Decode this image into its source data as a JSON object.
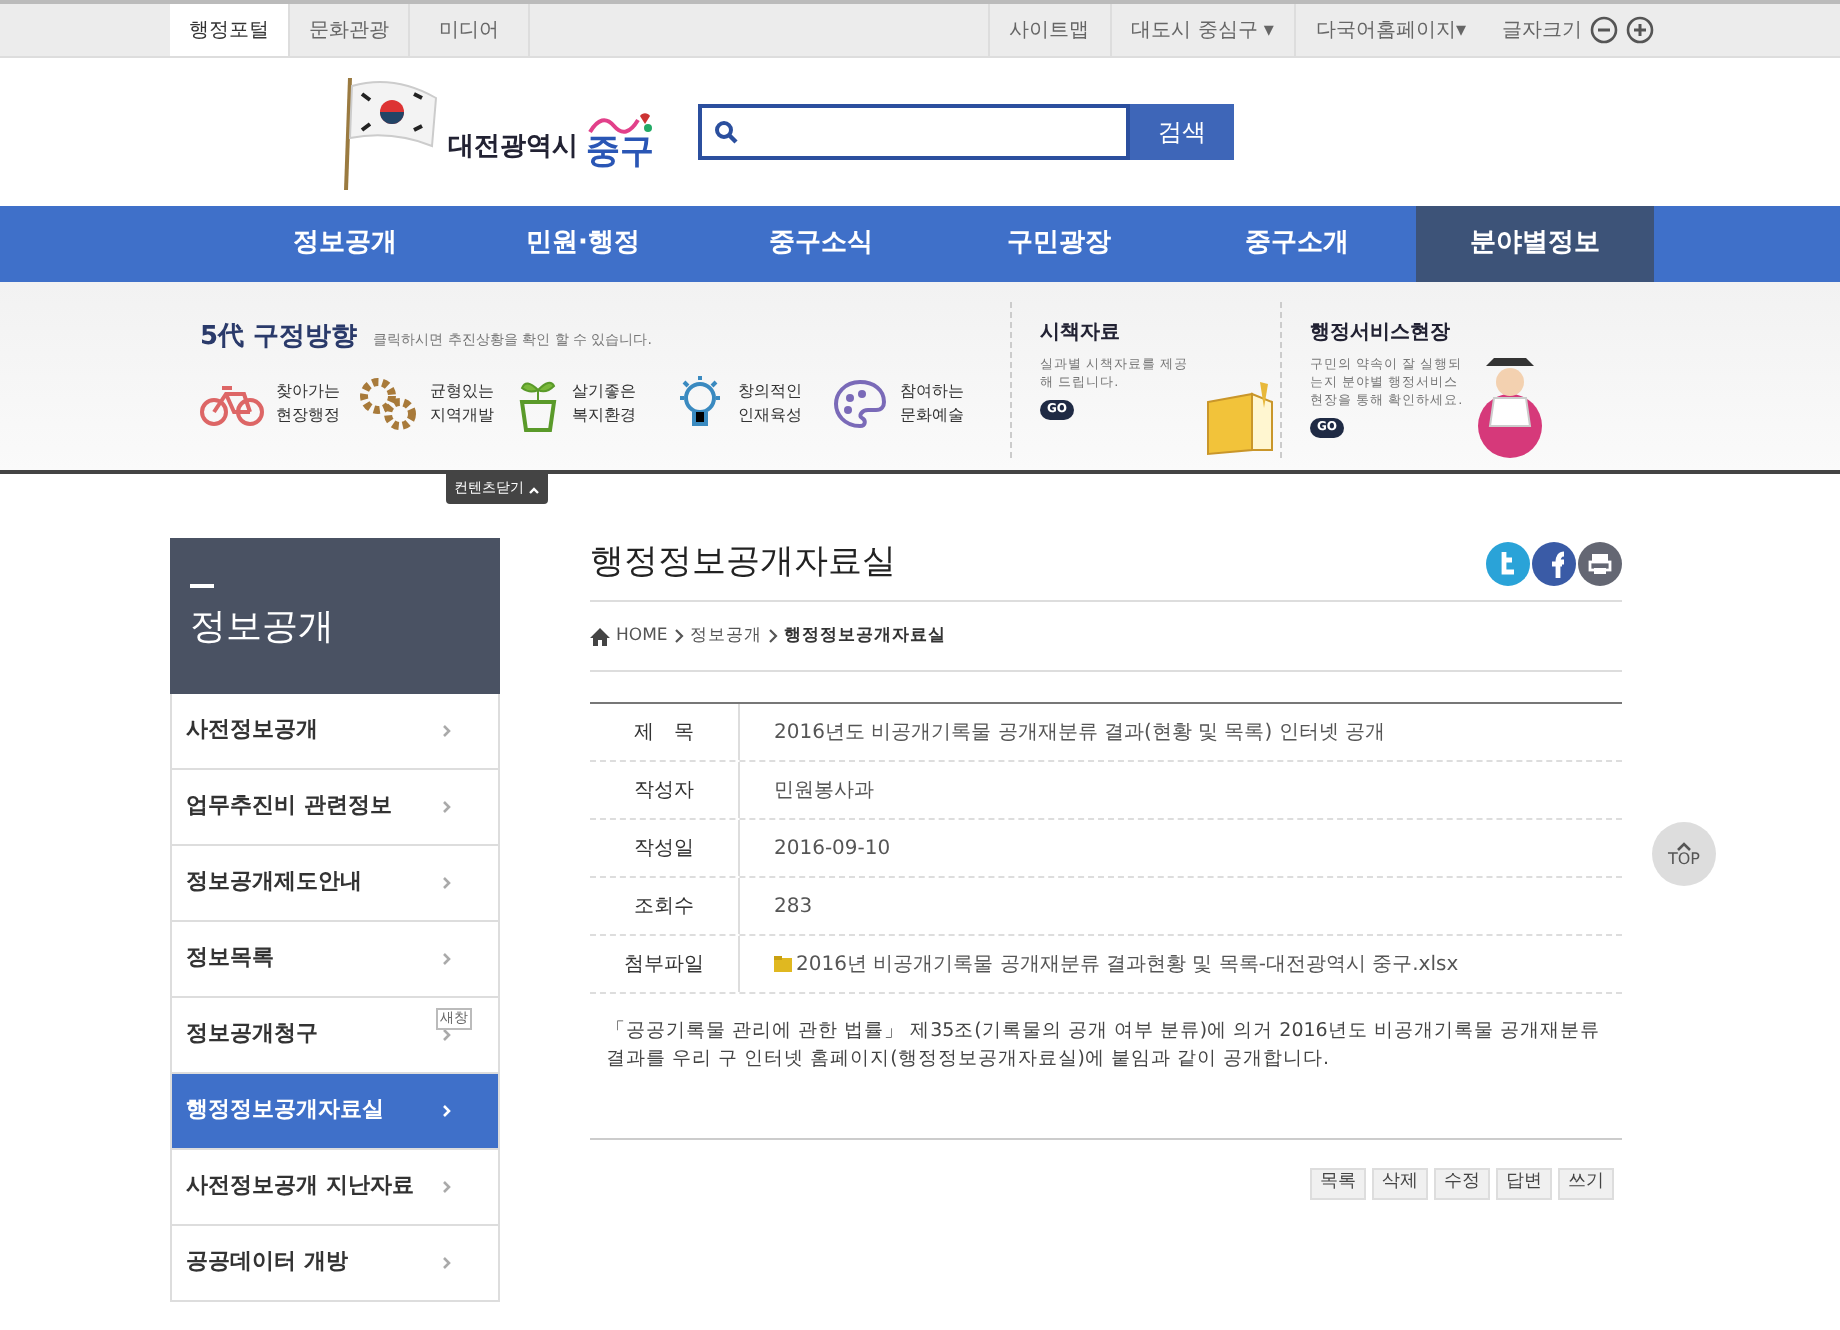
{
  "top_bar": {
    "tabs": [
      {
        "label": "행정포털",
        "selected": true
      },
      {
        "label": "문화관광",
        "selected": false
      },
      {
        "label": "미디어",
        "selected": false
      }
    ],
    "links": [
      {
        "label": "사이트맵",
        "kind": "link"
      },
      {
        "label": "대도시 중심구 ▾",
        "kind": "dropdown"
      },
      {
        "label": "다국어홈페이지▾",
        "kind": "dropdown"
      },
      {
        "label": "글자크기",
        "kind": "zoom"
      }
    ]
  },
  "header": {
    "logo_city": "대전광역시",
    "logo_district": "중구",
    "search_button": "검색"
  },
  "main_nav": [
    {
      "label": "정보공개",
      "selected": false
    },
    {
      "label": "민원·행정",
      "selected": false
    },
    {
      "label": "중구소식",
      "selected": false
    },
    {
      "label": "구민광장",
      "selected": false
    },
    {
      "label": "중구소개",
      "selected": false
    },
    {
      "label": "분야별정보",
      "selected": true
    }
  ],
  "banner": {
    "title": "5代 구정방향",
    "subtitle": "클릭하시면 추진상황을 확인 할 수 있습니다.",
    "directions": [
      {
        "line1": "찾아가는",
        "line2": "현장행정",
        "kind": "bicycle"
      },
      {
        "line1": "균형있는",
        "line2": "지역개발",
        "kind": "gears"
      },
      {
        "line1": "살기좋은",
        "line2": "복지환경",
        "kind": "sprout"
      },
      {
        "line1": "창의적인",
        "line2": "인재육성",
        "kind": "bulb"
      },
      {
        "line1": "참여하는",
        "line2": "문화예술",
        "kind": "palette"
      }
    ],
    "promos": [
      {
        "title": "시책자료",
        "text": "실과별 시책자료를 제공해 드립니다.",
        "go": "GO",
        "kind": "book"
      },
      {
        "title": "행정서비스현장",
        "text": "구민의 약속이 잘 실행되는지 분야별 행정서비스현장을 통해 확인하세요.",
        "go": "GO",
        "kind": "person"
      }
    ],
    "close_tab": "컨텐츠닫기"
  },
  "sidebar": {
    "title": "정보공개",
    "items": [
      {
        "label": "사전정보공개",
        "selected": false
      },
      {
        "label": "업무추진비 관련정보",
        "selected": false
      },
      {
        "label": "정보공개제도안내",
        "selected": false
      },
      {
        "label": "정보목록",
        "selected": false
      },
      {
        "label": "정보공개청구",
        "selected": false,
        "badge": "새창"
      },
      {
        "label": "행정정보공개자료실",
        "selected": true
      },
      {
        "label": "사전정보공개 지난자료",
        "selected": false
      },
      {
        "label": "공공데이터 개방",
        "selected": false
      }
    ]
  },
  "content": {
    "title": "행정정보공개자료실",
    "breadcrumb": [
      "HOME",
      "정보공개",
      "행정정보공개자료실"
    ],
    "fields": [
      {
        "label": "제　목",
        "value": "2016년도 비공개기록물 공개재분류 결과(현황 및 목록) 인터넷 공개",
        "kind": "text"
      },
      {
        "label": "작성자",
        "value": "민원봉사과",
        "kind": "text"
      },
      {
        "label": "작성일",
        "value": "2016-09-10",
        "kind": "text"
      },
      {
        "label": "조회수",
        "value": "283",
        "kind": "text"
      },
      {
        "label": "첨부파일",
        "value": "2016년 비공개기록물 공개재분류 결과현황 및 목록-대전광역시 중구.xlsx",
        "kind": "file"
      }
    ],
    "body": "「공공기록물 관리에 관한 법률」 제35조(기록물의 공개 여부 분류)에 의거 2016년도 비공개기록물 공개재분류 결과를 우리 구 인터넷 홈페이지(행정정보공개자료실)에 붙임과 같이 공개합니다.",
    "buttons": [
      "목록",
      "삭제",
      "수정",
      "답변",
      "쓰기"
    ]
  },
  "top_button": "TOP"
}
